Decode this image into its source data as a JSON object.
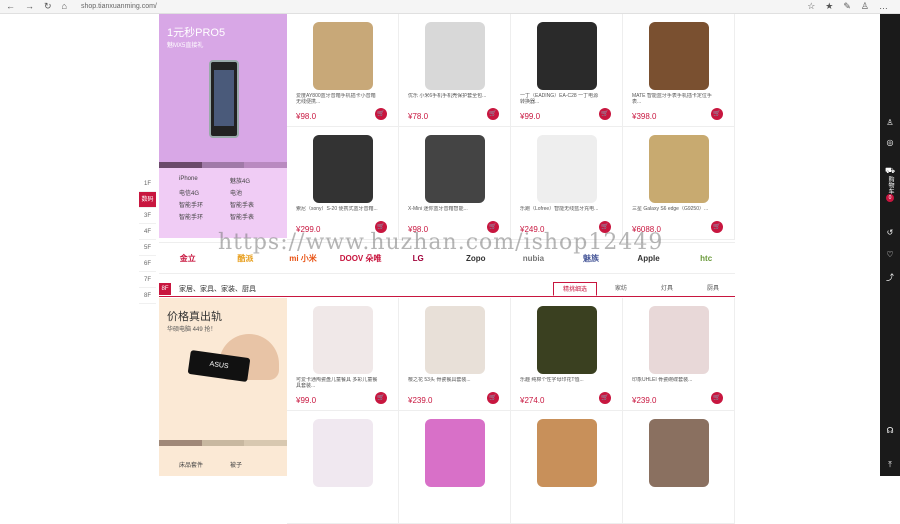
{
  "browser": {
    "address": "shop.tianxuanming.com/",
    "nav": [
      "←",
      "→",
      "↻",
      "⌂"
    ],
    "tools": [
      "☆",
      "★",
      "✎",
      "♙",
      "…"
    ]
  },
  "floor_nav": [
    "1F",
    "数码",
    "3F",
    "4F",
    "5F",
    "6F",
    "7F",
    "8F"
  ],
  "floor_nav_active": 1,
  "right_bar": {
    "cart_label": "购物车",
    "cart_count": "0",
    "icons": [
      "user-icon",
      "gift-icon",
      "cart-icon",
      "history-icon",
      "heart-icon",
      "share-icon",
      "headset-icon",
      "top-icon"
    ]
  },
  "promo1": {
    "title": "1元秒PRO5",
    "subtitle": "魅MX5直接礼",
    "categories": [
      "iPhone",
      "魅族4G",
      "电信4G",
      "电池",
      "智能手环",
      "智能手表",
      "智能手环",
      "智能手表"
    ]
  },
  "row1_products": [
    {
      "name": "爱度AY800蓝牙音箱手机插卡小音箱无线便携...",
      "price": "¥98.0",
      "color": "#c8a878"
    },
    {
      "name": "优乐 小米6手机手机壳保护套全包...",
      "price": "¥78.0",
      "color": "#d8d8d8"
    },
    {
      "name": "一丁（EADING）EA-C28 一丁电源转换器...",
      "price": "¥99.0",
      "color": "#2a2a2a"
    },
    {
      "name": "MATE 智能蓝牙手表手机插卡定位手表...",
      "price": "¥398.0",
      "color": "#7a5030"
    },
    {
      "name": "索尼（sony）S-20 便携式蓝牙音箱...",
      "price": "¥299.0",
      "color": "#333333"
    },
    {
      "name": "X-Mini 迷你蓝牙音箱智能...",
      "price": "¥98.0",
      "color": "#444444"
    },
    {
      "name": "乐跑（Lofree）智能无线蓝牙充电...",
      "price": "¥249.0",
      "color": "#eeeeee"
    },
    {
      "name": "三星 Galaxy S6 edge（G9250）...",
      "price": "¥6088.0",
      "color": "#c8aa70"
    }
  ],
  "brands": [
    {
      "name": "金立",
      "color": "#c8163f"
    },
    {
      "name": "酷派",
      "color": "#e8a020"
    },
    {
      "name": "mi 小米",
      "color": "#e85010"
    },
    {
      "name": "DOOV 朵唯",
      "color": "#c8163f"
    },
    {
      "name": "LG",
      "color": "#a0003a"
    },
    {
      "name": "Zopo",
      "color": "#333333"
    },
    {
      "name": "nubia",
      "color": "#777777"
    },
    {
      "name": "魅族",
      "color": "#4a5a9a"
    },
    {
      "name": "Apple",
      "color": "#333333"
    },
    {
      "name": "htc",
      "color": "#6a9a3a"
    }
  ],
  "floor2": {
    "num": "8F",
    "label": "家居、家具、家装、厨具",
    "tabs": [
      "精挑细选",
      "家纺",
      "灯具",
      "厨具"
    ],
    "active_tab": 0
  },
  "promo2": {
    "title": "价格真出轨",
    "subtitle": "华硕电脑 449 抢！",
    "stick_text": "ASUS",
    "categories": [
      "床品套件",
      "被子"
    ]
  },
  "row2_products": [
    {
      "name": "可爱卡通陶瓷盘儿童餐具 多彩儿童餐具套装...",
      "price": "¥99.0",
      "color": "#f0e8e8"
    },
    {
      "name": "樱之花 53头 骨瓷餐具套装...",
      "price": "¥239.0",
      "color": "#e8e0d8"
    },
    {
      "name": "乐趣 纯棉个性字母印花T恤...",
      "price": "¥274.0",
      "color": "#3a4020"
    },
    {
      "name": "印象UHLEI 骨瓷碗碟套装...",
      "price": "¥239.0",
      "color": "#e8d8d8"
    },
    {
      "name": "",
      "price": "",
      "color": "#f0e8f0"
    },
    {
      "name": "",
      "price": "",
      "color": "#d870c8"
    },
    {
      "name": "",
      "price": "",
      "color": "#c8905a"
    },
    {
      "name": "",
      "price": "",
      "color": "#8a7060"
    }
  ],
  "watermark": "https://www.huzhan.com/ishop12449"
}
